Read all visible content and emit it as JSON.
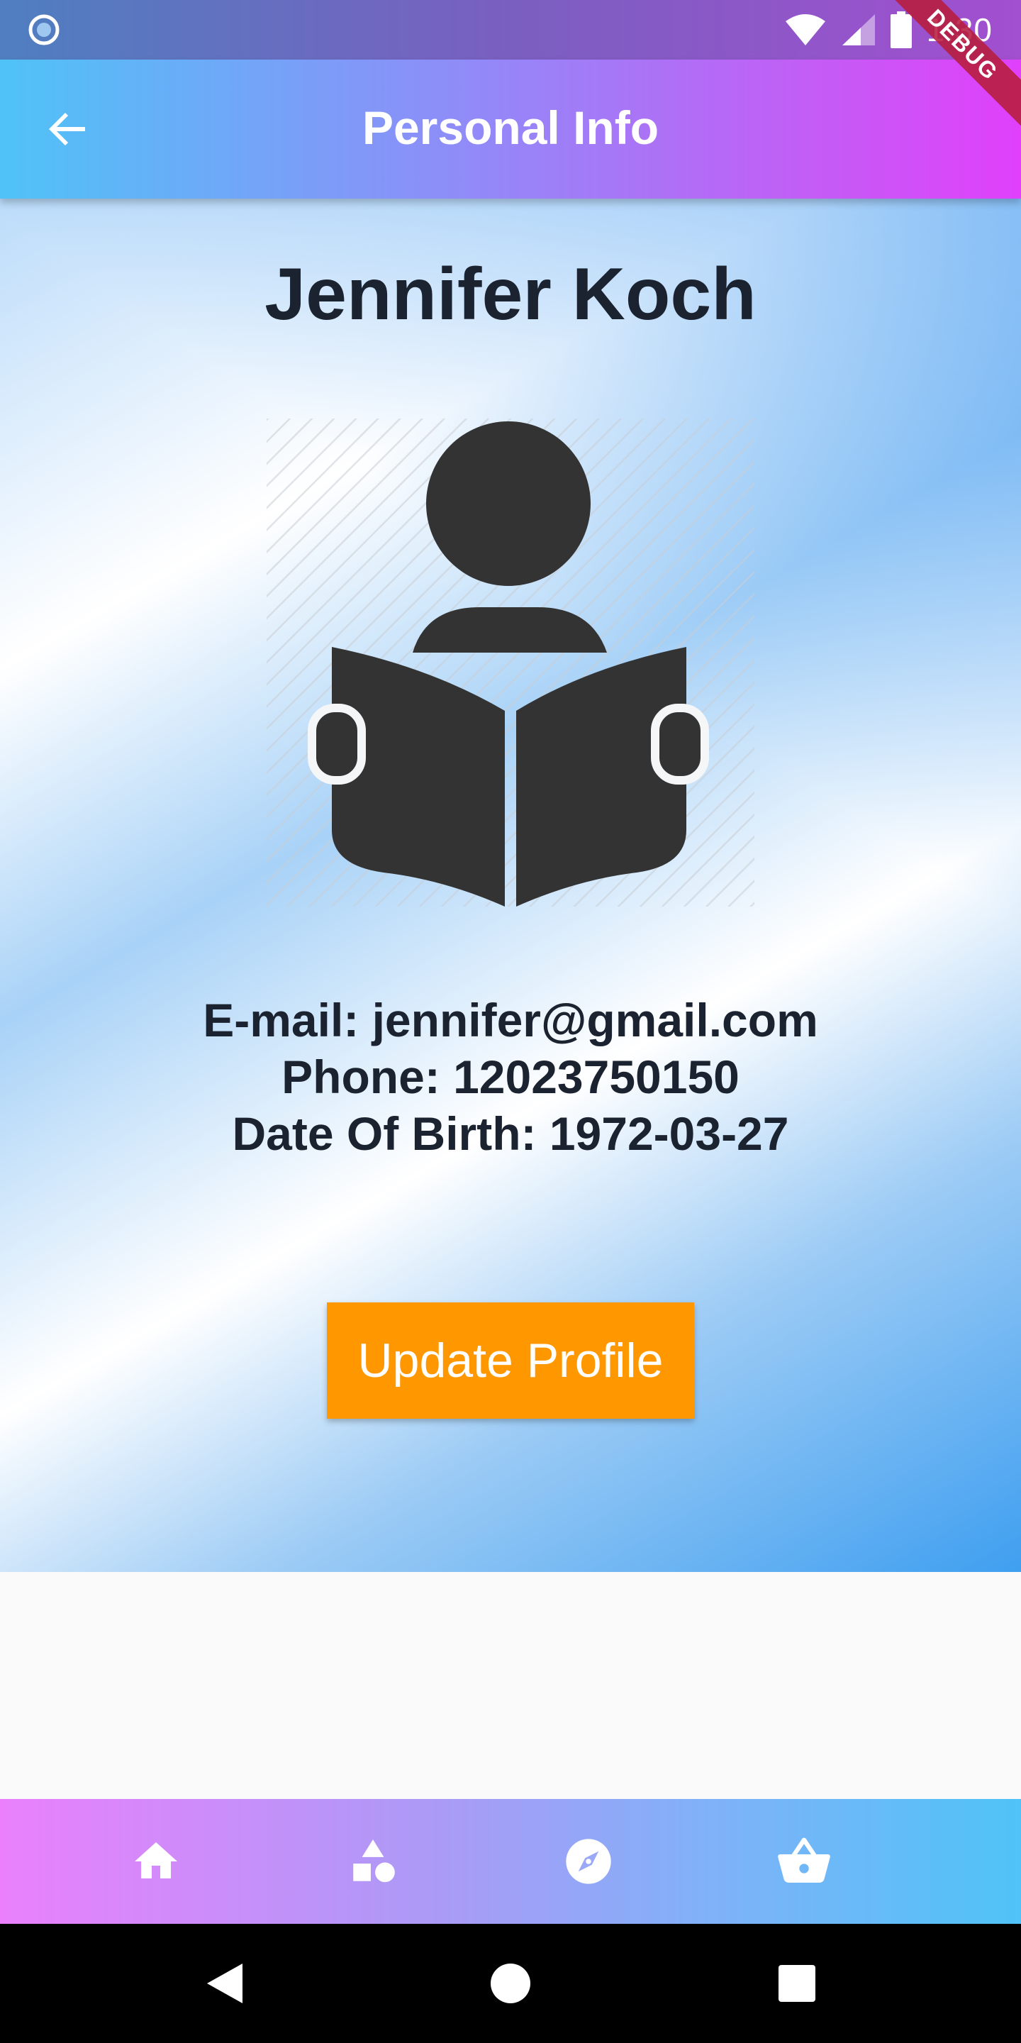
{
  "status_bar": {
    "time": "1:30",
    "icons": [
      "notification-dot-icon",
      "wifi-icon",
      "signal-icon",
      "battery-icon"
    ],
    "debug_banner": "DEBUG"
  },
  "app_bar": {
    "title": "Personal Info",
    "back_icon": "arrow-back-icon",
    "gradient": [
      "#4fc3f7",
      "#e040fb"
    ]
  },
  "profile": {
    "name": "Jennifer Koch",
    "avatar_icon": "reader-book-icon",
    "email_line": "E-mail: jennifer@gmail.com",
    "phone_line": "Phone: 12023750150",
    "dob_line": "Date Of Birth: 1972-03-27"
  },
  "update_button": {
    "label": "Update Profile",
    "color": "#ff9800"
  },
  "bottom_nav": {
    "items": [
      {
        "icon": "home-icon"
      },
      {
        "icon": "shapes-icon"
      },
      {
        "icon": "compass-icon"
      },
      {
        "icon": "basket-icon"
      }
    ],
    "gradient": [
      "#ea80fc",
      "#4fc3f7"
    ]
  },
  "system_nav": {
    "icons": [
      "back-triangle-icon",
      "home-circle-icon",
      "recents-square-icon"
    ]
  }
}
